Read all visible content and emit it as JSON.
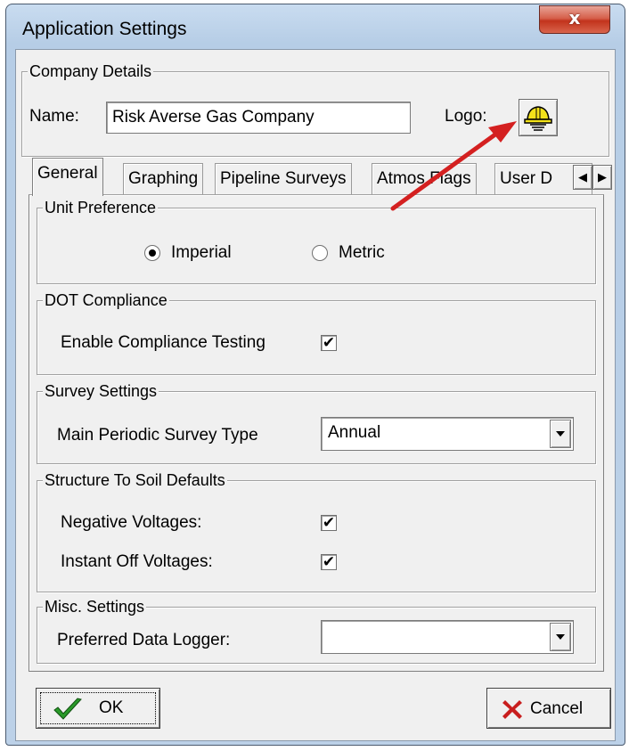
{
  "window": {
    "title": "Application Settings",
    "close_label": "x"
  },
  "company": {
    "legend": "Company Details",
    "name_label": "Name:",
    "name_value": "Risk Averse Gas Company",
    "logo_label": "Logo:"
  },
  "tabs": [
    {
      "label": "General"
    },
    {
      "label": "Graphing"
    },
    {
      "label": "Pipeline Surveys"
    },
    {
      "label": "Atmos Flags"
    },
    {
      "label": "User D"
    }
  ],
  "tab_scroll": {
    "left": "◀",
    "right": "▶"
  },
  "unit_preference": {
    "legend": "Unit Preference",
    "options": [
      {
        "label": "Imperial",
        "selected": true
      },
      {
        "label": "Metric",
        "selected": false
      }
    ]
  },
  "dot_compliance": {
    "legend": "DOT Compliance",
    "enable_label": "Enable Compliance Testing",
    "enable_checked": true,
    "check_glyph": "✔"
  },
  "survey_settings": {
    "legend": "Survey Settings",
    "type_label": "Main Periodic Survey Type",
    "type_value": "Annual"
  },
  "structure_to_soil": {
    "legend": "Structure To Soil Defaults",
    "negative_label": "Negative Voltages:",
    "negative_checked": true,
    "instant_off_label": "Instant Off Voltages:",
    "instant_off_checked": true
  },
  "misc": {
    "legend": "Misc. Settings",
    "logger_label": "Preferred Data Logger:",
    "logger_value": ""
  },
  "buttons": {
    "ok": "OK",
    "cancel": "Cancel"
  },
  "colors": {
    "arrow": "#d42020",
    "ok_check": "#2a9a2a",
    "cancel_x": "#c81e1e",
    "helmet": "#f2e21a"
  }
}
